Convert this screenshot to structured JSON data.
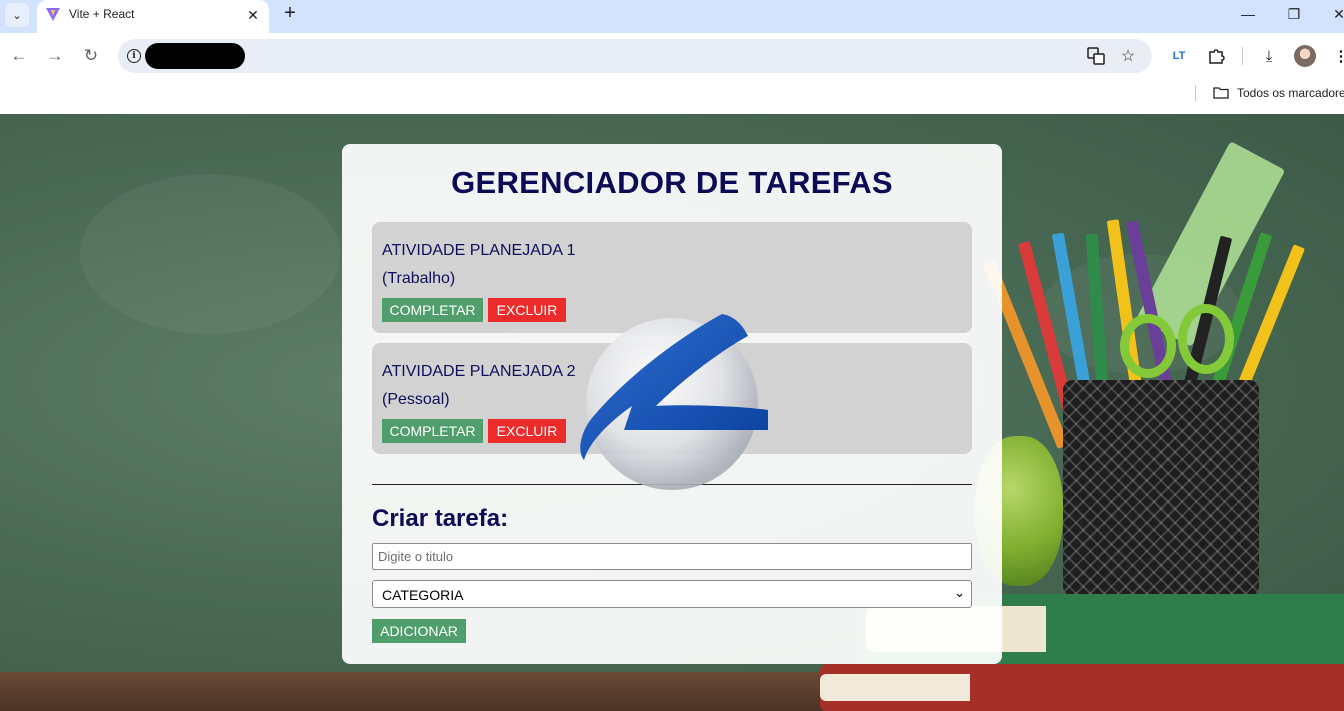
{
  "browser": {
    "tab": {
      "title": "Vite + React"
    },
    "bookmarks_bar": {
      "all_bookmarks_label": "Todos os marcadore"
    },
    "icons": {
      "tab_favicon": "vite-logo-icon",
      "translate": "translate-icon",
      "star": "bookmark-star-icon",
      "extension": "puzzle-extension-icon",
      "download": "download-icon",
      "menu": "kebab-menu-icon"
    }
  },
  "app": {
    "title": "GERENCIADOR DE TAREFAS",
    "tasks": [
      {
        "title": "ATIVIDADE PLANEJADA 1",
        "category": "(Trabalho)",
        "complete_label": "COMPLETAR",
        "delete_label": "EXCLUIR"
      },
      {
        "title": "ATIVIDADE PLANEJADA 2",
        "category": "(Pessoal)",
        "complete_label": "COMPLETAR",
        "delete_label": "EXCLUIR"
      }
    ],
    "form": {
      "title": "Criar tarefa:",
      "title_input_placeholder": "Digite o titulo",
      "title_input_value": "",
      "category_selected": "CATEGORIA",
      "add_label": "ADICIONAR"
    }
  },
  "colors": {
    "title_navy": "#0b0b56",
    "complete_green": "#4f9e6b",
    "delete_red": "#ee2b2b",
    "card_gray": "#d2d2d2"
  }
}
